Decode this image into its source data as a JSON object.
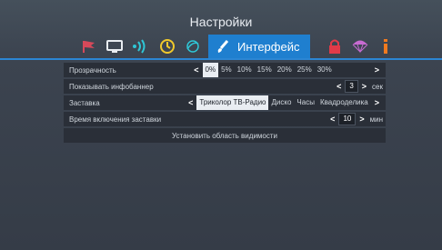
{
  "title": "Настройки",
  "tabs": {
    "active_label": "Интерфейс",
    "icons": [
      "flag-icon",
      "tv-icon",
      "signal-icon",
      "clock-icon",
      "satellite-icon",
      "brush-icon",
      "lock-icon",
      "parachute-icon",
      "info-icon"
    ]
  },
  "rows": {
    "transparency": {
      "label": "Прозрачность",
      "options": [
        "0%",
        "5%",
        "10%",
        "15%",
        "20%",
        "25%",
        "30%"
      ],
      "selected": "0%"
    },
    "infobanner": {
      "label": "Показывать инфобаннер",
      "value": "3",
      "unit": "сек"
    },
    "screensaver": {
      "label": "Заставка",
      "options": [
        "Триколор ТВ-Радио",
        "Диско",
        "Часы",
        "Квадроделика"
      ],
      "selected": "Триколор ТВ-Радио"
    },
    "screensaver_time": {
      "label": "Время включения заставки",
      "value": "10",
      "unit": "мин"
    },
    "visible_area": {
      "label": "Установить область видимости"
    }
  },
  "colors": {
    "accent": "#1f7fcf",
    "background": "#3f4552"
  }
}
